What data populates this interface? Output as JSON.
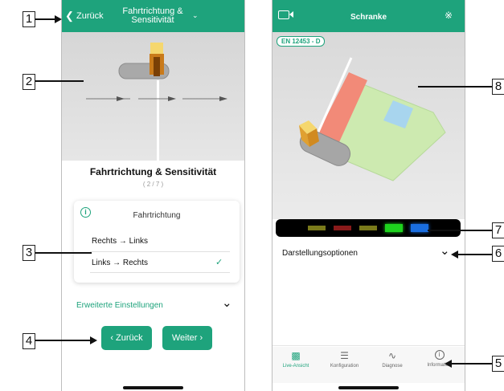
{
  "callouts": {
    "c1": "1",
    "c2": "2",
    "c3": "3",
    "c4": "4",
    "c5": "5",
    "c6": "6",
    "c7": "7",
    "c8": "8"
  },
  "left": {
    "header": {
      "back_label": "Zurück",
      "title_line1": "Fahrtrichtung &",
      "title_line2": "Sensitivität"
    },
    "section_title": "Fahrtrichtung & Sensitivität",
    "step": "( 2 / 7 )",
    "card": {
      "title": "Fahrtrichtung",
      "options": [
        "Rechts → Links",
        "Links → Rechts"
      ],
      "selected_index": 1
    },
    "advanced_label": "Erweiterte Einstellungen",
    "buttons": {
      "back": "Zurück",
      "next": "Weiter"
    }
  },
  "right": {
    "header_title": "Schranke",
    "badge": "EN 12453 - D",
    "display_options_label": "Darstellungsoptionen",
    "color_bar": [
      "#7a7a1a",
      "#8a1a1a",
      "#7a7a1a",
      "#1ed21e",
      "#1a6ee0"
    ],
    "tabs": [
      "Live-Ansicht",
      "Konfiguration",
      "Diagnose",
      "Information"
    ],
    "active_tab": "Live-Ansicht",
    "accent": "#1ea37c"
  }
}
